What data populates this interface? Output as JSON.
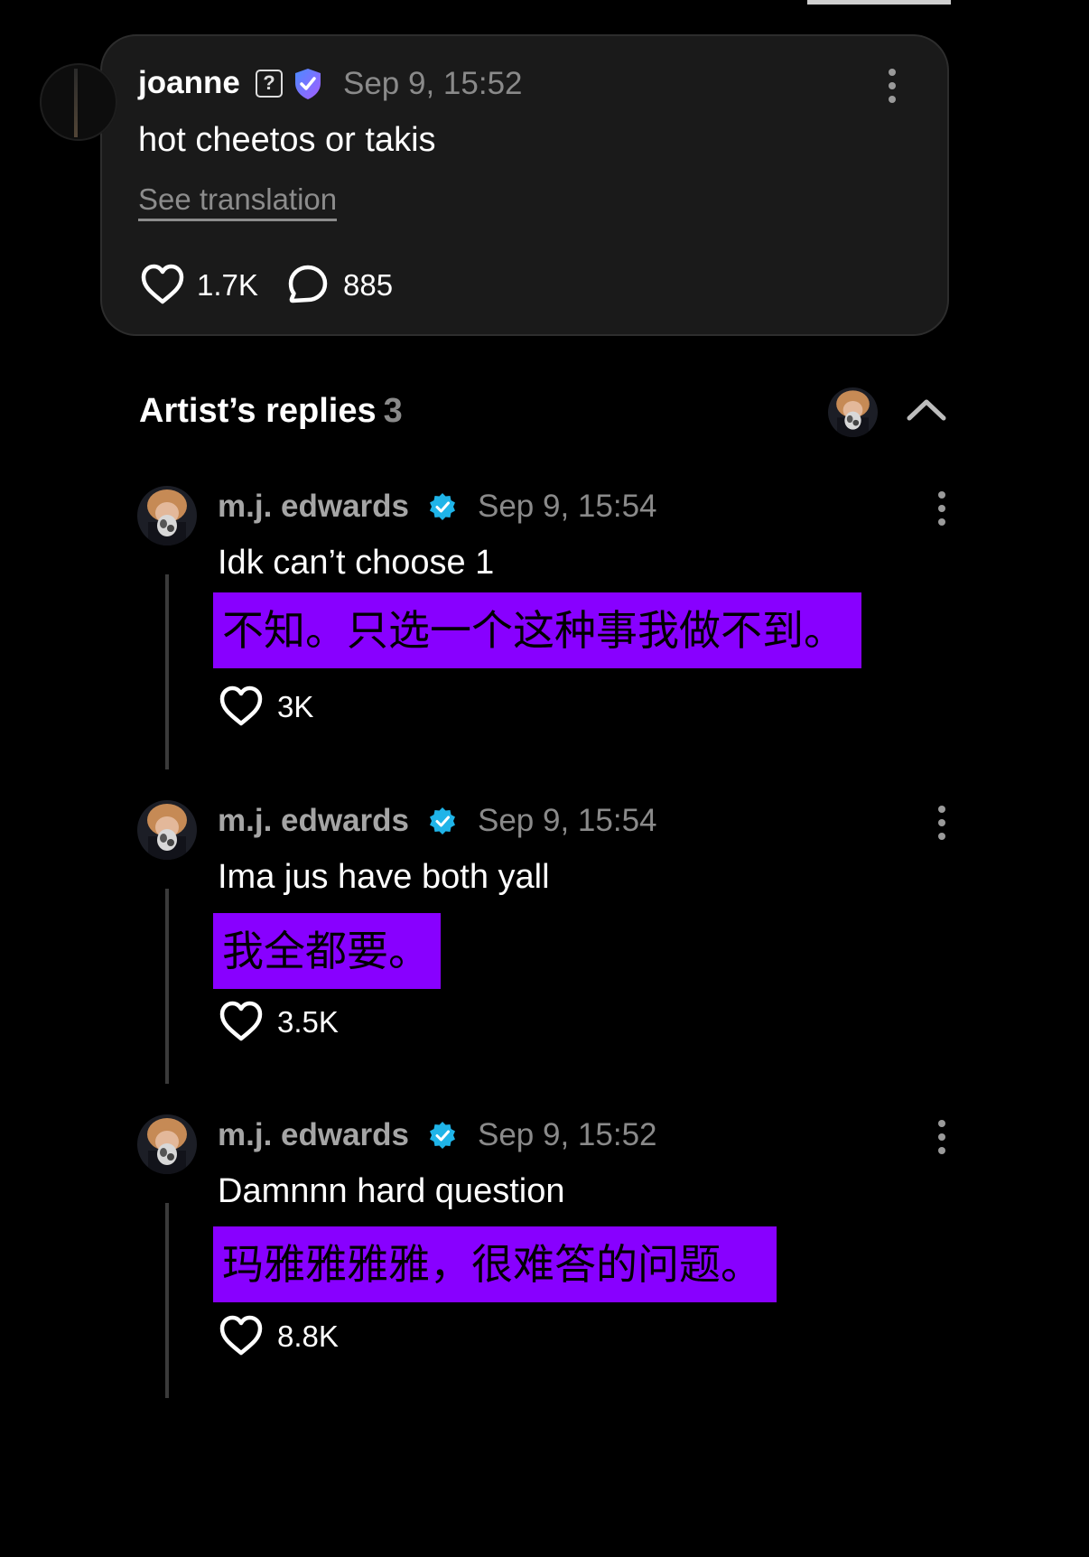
{
  "post": {
    "username": "joanne",
    "help_symbol": "?",
    "timestamp": "Sep 9, 15:52",
    "text": "hot cheetos or takis",
    "see_translation": "See translation",
    "likes": "1.7K",
    "comments": "885"
  },
  "replies_section": {
    "title": "Artist’s replies",
    "count": "3"
  },
  "replies": [
    {
      "username": "m.j. edwards",
      "timestamp": "Sep 9, 15:54",
      "text": "Idk can’t choose 1",
      "translation": "不知。只选一个这种事我做不到。",
      "likes": "3K"
    },
    {
      "username": "m.j. edwards",
      "timestamp": "Sep 9, 15:54",
      "text": "Ima jus have both yall",
      "translation": "我全都要。",
      "likes": "3.5K"
    },
    {
      "username": "m.j. edwards",
      "timestamp": "Sep 9, 15:52",
      "text": "Damnnn hard question",
      "translation": "玛雅雅雅雅，很难答的问题。",
      "likes": "8.8K"
    }
  ],
  "colors": {
    "background": "#000000",
    "card": "#1a1a1a",
    "translation_highlight": "#8800ff",
    "verified": "#1fb4e8",
    "shield": "#7b6cff",
    "muted_text": "#8a8a8a"
  }
}
